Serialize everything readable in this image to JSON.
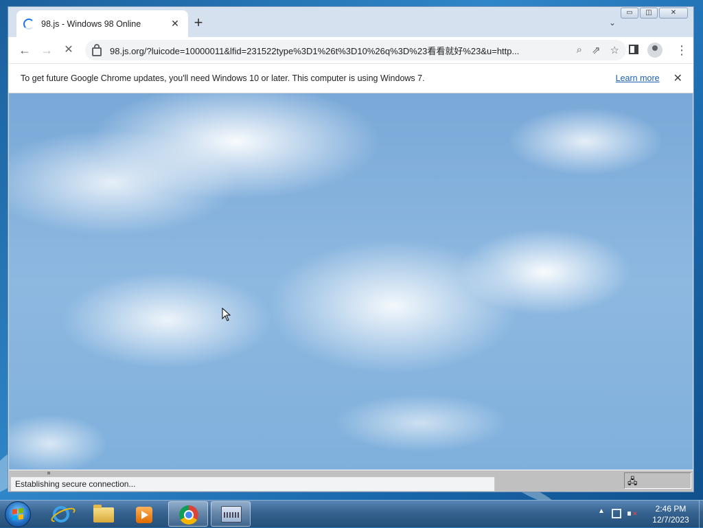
{
  "browser": {
    "tab": {
      "title": "98.js - Windows 98 Online",
      "close_glyph": "✕"
    },
    "new_tab_glyph": "+",
    "tab_search_glyph": "⌄",
    "caption": {
      "minimize": "▭",
      "maximize": "◫",
      "close": "✕"
    },
    "toolbar": {
      "back_glyph": "←",
      "forward_glyph": "→",
      "stop_glyph": "✕",
      "url": "98.js.org/?luicode=10000011&lfid=231522type%3D1%26t%3D10%26q%3D%23看看就好%23&u=http...",
      "zoom_glyph": "⌕",
      "share_glyph": "⇗",
      "bookmark_glyph": "☆",
      "menu_glyph": "⋮"
    },
    "infobar": {
      "message": "To get future Google Chrome updates, you'll need Windows 10 or later. This computer is using Windows 7.",
      "learn_more": "Learn more",
      "close_glyph": "✕"
    },
    "status": {
      "text": "Establishing secure connection..."
    },
    "win98_tray_glyph": "🖧"
  },
  "taskbar": {
    "items": [
      {
        "name": "Internet Explorer",
        "active": false
      },
      {
        "name": "Windows Explorer",
        "active": false
      },
      {
        "name": "Windows Media Player",
        "active": false
      },
      {
        "name": "Google Chrome",
        "active": true
      },
      {
        "name": "On-Screen Keyboard",
        "active": true
      }
    ],
    "tray_expand_glyph": "▲",
    "clock": {
      "time": "2:46 PM",
      "date": "12/7/2023"
    }
  },
  "colors": {
    "accent": "#1a73e8",
    "link": "#1a5fb4",
    "taskbar": "#36628f"
  }
}
